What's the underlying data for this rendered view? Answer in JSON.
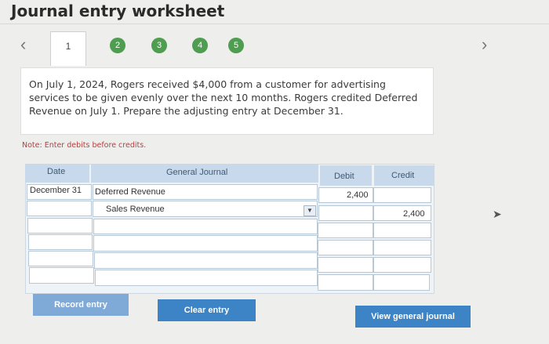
{
  "header": {
    "title": "Journal entry worksheet"
  },
  "nav": {
    "prev_icon": "chevron-left-icon",
    "next_icon": "chevron-right-icon",
    "prev_glyph": "‹",
    "next_glyph": "›",
    "steps": [
      {
        "label": "1",
        "active": true
      },
      {
        "label": "2",
        "active": false
      },
      {
        "label": "3",
        "active": false
      },
      {
        "label": "4",
        "active": false
      },
      {
        "label": "5",
        "active": false
      }
    ]
  },
  "question": {
    "text": "On July 1, 2024, Rogers received $4,000 from a customer for advertising services to be given evenly over the next 10 months. Rogers credited Deferred Revenue on July 1. Prepare the adjusting entry at December 31."
  },
  "note": "Note: Enter debits before credits.",
  "journal": {
    "headers": {
      "date": "Date",
      "general_journal": "General Journal",
      "debit": "Debit",
      "credit": "Credit"
    },
    "rows": [
      {
        "date": "December 31",
        "account": "Deferred Revenue",
        "debit": "2,400",
        "credit": ""
      },
      {
        "date": "",
        "account": "Sales Revenue",
        "debit": "",
        "credit": "2,400"
      },
      {
        "date": "",
        "account": "",
        "debit": "",
        "credit": ""
      },
      {
        "date": "",
        "account": "",
        "debit": "",
        "credit": ""
      },
      {
        "date": "",
        "account": "",
        "debit": "",
        "credit": ""
      },
      {
        "date": "",
        "account": "",
        "debit": "",
        "credit": ""
      }
    ]
  },
  "buttons": {
    "record": "Record entry",
    "clear": "Clear entry",
    "view": "View general journal"
  },
  "colors": {
    "step_green": "#4e9d50",
    "header_blue": "#c7d9ea",
    "button_blue": "#3d84c6",
    "question_bg": "#ffffff",
    "page_bg": "#eeeeec"
  }
}
